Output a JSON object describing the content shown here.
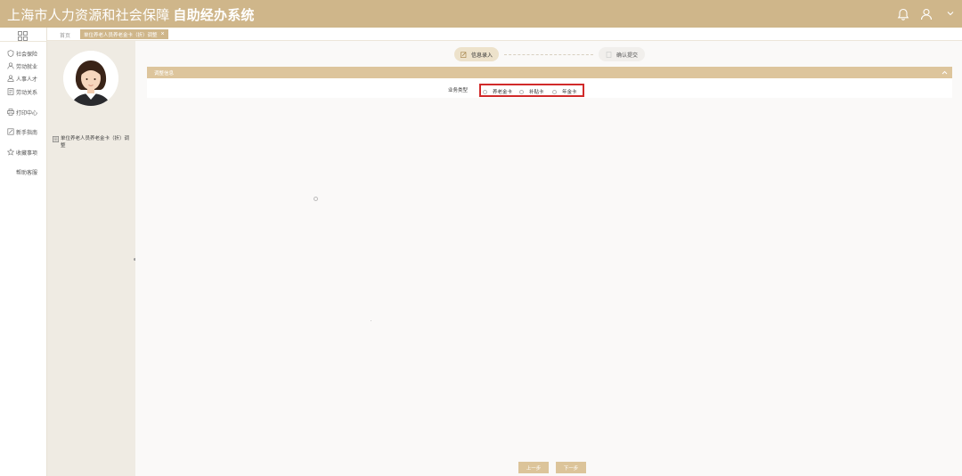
{
  "header": {
    "title_main": "上海市人力资源和社会保障",
    "title_sys": "自助经办系统",
    "icons": [
      "bell-icon",
      "user-icon",
      "chevron-down-icon"
    ]
  },
  "nav": {
    "items": [
      {
        "label": "社会保险",
        "icon": "shield-icon"
      },
      {
        "label": "劳动就业",
        "icon": "person-icon"
      },
      {
        "label": "人事人才",
        "icon": "people-icon"
      },
      {
        "label": "劳动关系",
        "icon": "document-icon"
      },
      {
        "label": "打印中心",
        "icon": "printer-icon"
      },
      {
        "label": "新手指南",
        "icon": "guide-icon"
      },
      {
        "label": "收藏事项",
        "icon": "star-icon"
      },
      {
        "label": "帮助客服",
        "icon": ""
      }
    ]
  },
  "tabs": {
    "home": "首页",
    "active": "单位养老人员养老金卡（折）调整",
    "close": "×"
  },
  "profile": {
    "process_name": "单位养老人员养老金卡（折）调整"
  },
  "steps": {
    "step1": "信息录入",
    "step2": "确认提交"
  },
  "section": {
    "title": "调整信息"
  },
  "form": {
    "label": "业务类型",
    "options": [
      "养老金卡",
      "补贴卡",
      "年金卡"
    ]
  },
  "buttons": {
    "prev": "上一步",
    "next": "下一步"
  },
  "colors": {
    "brand": "#cfb68a",
    "section": "#ddc59c",
    "highlight": "#d12a2a"
  }
}
